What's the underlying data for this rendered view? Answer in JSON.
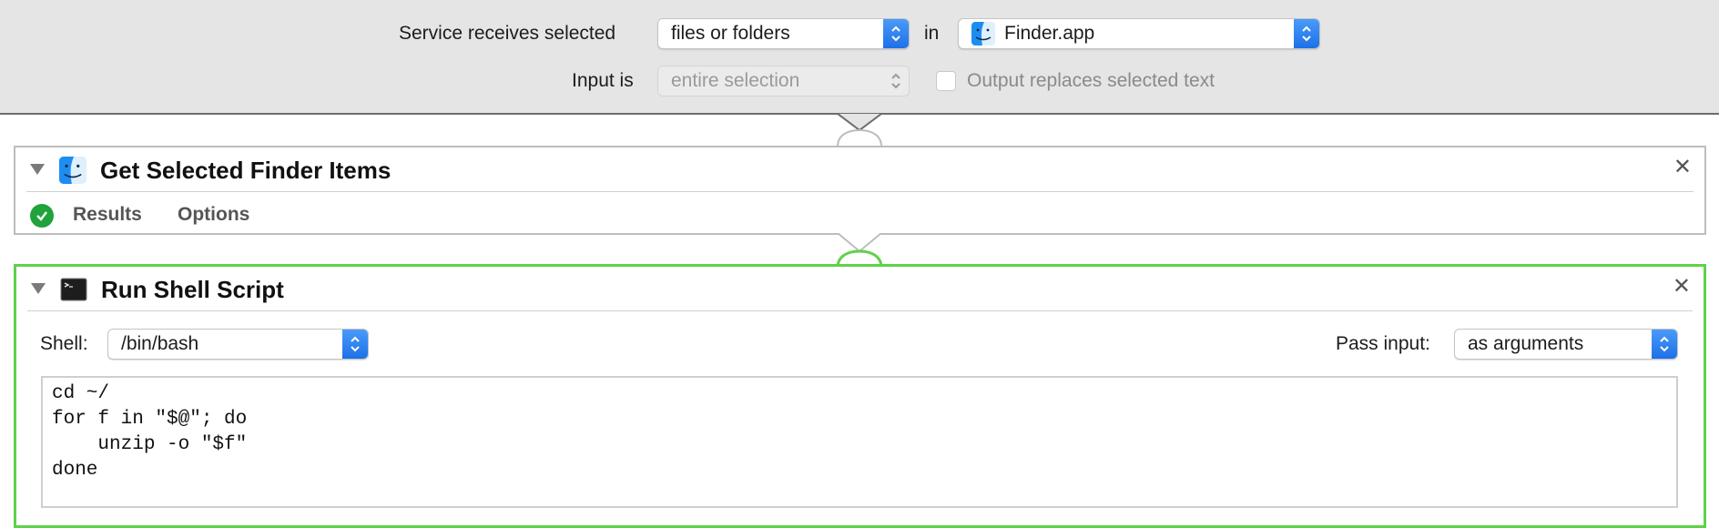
{
  "service": {
    "receives_label": "Service receives selected",
    "receives_value": "files or folders",
    "in_label": "in",
    "app_value": "Finder.app",
    "input_label": "Input is",
    "input_value": "entire selection",
    "output_replaces_label": "Output replaces selected text",
    "output_replaces_checked": false
  },
  "actions": [
    {
      "title": "Get Selected Finder Items",
      "icon": "finder-icon",
      "status": "success-check-icon",
      "tabs": [
        "Results",
        "Options"
      ]
    },
    {
      "title": "Run Shell Script",
      "icon": "terminal-icon",
      "shell_label": "Shell:",
      "shell_value": "/bin/bash",
      "pass_input_label": "Pass input:",
      "pass_input_value": "as arguments",
      "script": "cd ~/\nfor f in \"$@\"; do\n    unzip -o \"$f\"\ndone"
    }
  ],
  "colors": {
    "accent_blue": "#1c6fe6",
    "selected_action_border": "#5fd14a",
    "success_green": "#1fa33a",
    "header_bg": "#e5e5e5"
  }
}
